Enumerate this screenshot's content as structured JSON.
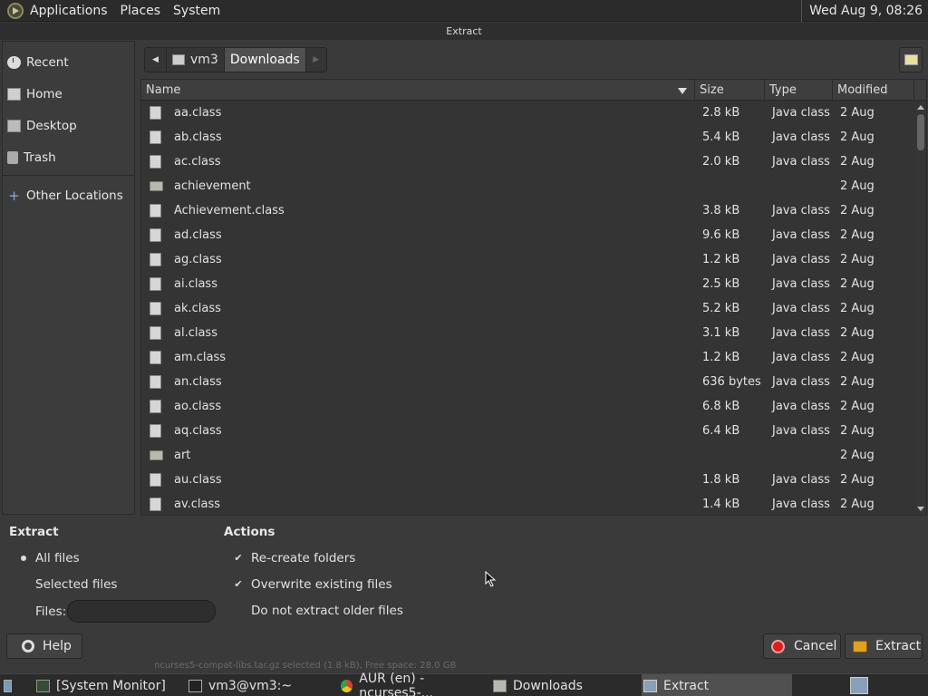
{
  "top_panel": {
    "menus": [
      "Applications",
      "Places",
      "System"
    ],
    "clock": "Wed Aug  9, 08:26"
  },
  "dialog": {
    "title": "Extract"
  },
  "sidebar": {
    "items": [
      {
        "label": "Recent",
        "icon": "clock-icon"
      },
      {
        "label": "Home",
        "icon": "home-icon"
      },
      {
        "label": "Desktop",
        "icon": "desktop-icon"
      },
      {
        "label": "Trash",
        "icon": "trash-icon"
      }
    ],
    "other_locations": "Other Locations"
  },
  "pathbar": {
    "segments": [
      "vm3",
      "Downloads"
    ]
  },
  "file_list": {
    "columns": [
      "Name",
      "Size",
      "Type",
      "Modified"
    ],
    "rows": [
      {
        "name": "aa.class",
        "size": "2.8 kB",
        "type": "Java class",
        "modified": "2 Aug",
        "kind": "file"
      },
      {
        "name": "ab.class",
        "size": "5.4 kB",
        "type": "Java class",
        "modified": "2 Aug",
        "kind": "file"
      },
      {
        "name": "ac.class",
        "size": "2.0 kB",
        "type": "Java class",
        "modified": "2 Aug",
        "kind": "file"
      },
      {
        "name": "achievement",
        "size": "",
        "type": "",
        "modified": "2 Aug",
        "kind": "folder"
      },
      {
        "name": "Achievement.class",
        "size": "3.8 kB",
        "type": "Java class",
        "modified": "2 Aug",
        "kind": "file"
      },
      {
        "name": "ad.class",
        "size": "9.6 kB",
        "type": "Java class",
        "modified": "2 Aug",
        "kind": "file"
      },
      {
        "name": "ag.class",
        "size": "1.2 kB",
        "type": "Java class",
        "modified": "2 Aug",
        "kind": "file"
      },
      {
        "name": "ai.class",
        "size": "2.5 kB",
        "type": "Java class",
        "modified": "2 Aug",
        "kind": "file"
      },
      {
        "name": "ak.class",
        "size": "5.2 kB",
        "type": "Java class",
        "modified": "2 Aug",
        "kind": "file"
      },
      {
        "name": "al.class",
        "size": "3.1 kB",
        "type": "Java class",
        "modified": "2 Aug",
        "kind": "file"
      },
      {
        "name": "am.class",
        "size": "1.2 kB",
        "type": "Java class",
        "modified": "2 Aug",
        "kind": "file"
      },
      {
        "name": "an.class",
        "size": "636 bytes",
        "type": "Java class",
        "modified": "2 Aug",
        "kind": "file"
      },
      {
        "name": "ao.class",
        "size": "6.8 kB",
        "type": "Java class",
        "modified": "2 Aug",
        "kind": "file"
      },
      {
        "name": "aq.class",
        "size": "6.4 kB",
        "type": "Java class",
        "modified": "2 Aug",
        "kind": "file"
      },
      {
        "name": "art",
        "size": "",
        "type": "",
        "modified": "2 Aug",
        "kind": "folder"
      },
      {
        "name": "au.class",
        "size": "1.8 kB",
        "type": "Java class",
        "modified": "2 Aug",
        "kind": "file"
      },
      {
        "name": "av.class",
        "size": "1.4 kB",
        "type": "Java class",
        "modified": "2 Aug",
        "kind": "file"
      }
    ]
  },
  "extract_options": {
    "title": "Extract",
    "all_files": "All files",
    "selected_files": "Selected files",
    "files_label": "Files:",
    "files_value": ""
  },
  "actions": {
    "title": "Actions",
    "recreate_folders": "Re-create folders",
    "overwrite_existing": "Overwrite existing files",
    "no_older": "Do not extract older files"
  },
  "buttons": {
    "help": "Help",
    "cancel": "Cancel",
    "extract": "Extract"
  },
  "status_line": "ncurses5-compat-libs.tar.gz selected (1.8 kB), Free space: 28.0 GB",
  "taskbar": {
    "items": [
      {
        "label": "[System Monitor]",
        "icon": "system-monitor-icon"
      },
      {
        "label": "vm3@vm3:~",
        "icon": "terminal-icon"
      },
      {
        "label": "AUR (en) - ncurses5-...",
        "icon": "chrome-icon"
      },
      {
        "label": "Downloads",
        "icon": "folder-icon"
      },
      {
        "label": "Extract",
        "icon": "archive-icon",
        "active": true
      }
    ]
  }
}
